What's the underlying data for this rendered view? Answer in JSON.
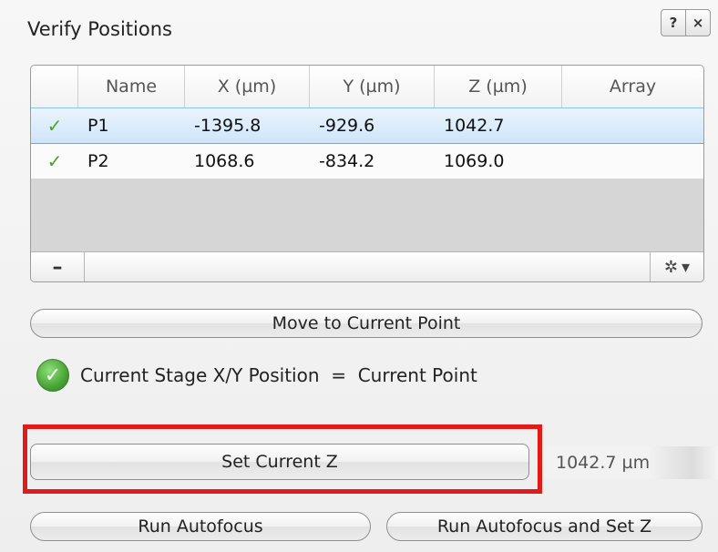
{
  "window": {
    "title": "Verify Positions",
    "help_label": "?",
    "close_label": "×"
  },
  "table": {
    "headers": [
      "",
      "Name",
      "X (µm)",
      "Y (µm)",
      "Z (µm)",
      "Array"
    ],
    "rows": [
      {
        "status": "✓",
        "name": "P1",
        "x": "-1395.8",
        "y": "-929.6",
        "z": "1042.7",
        "array": ""
      },
      {
        "status": "✓",
        "name": "P2",
        "x": "1068.6",
        "y": "-834.2",
        "z": "1069.0",
        "array": ""
      }
    ],
    "remove_label": "–",
    "options_label": "✲",
    "options_arrow": "▾"
  },
  "actions": {
    "move_label": "Move to Current Point",
    "set_z_label": "Set Current Z",
    "run_autofocus_label": "Run Autofocus",
    "run_autofocus_set_z_label": "Run Autofocus and Set Z"
  },
  "status": {
    "icon": "check-circle-icon",
    "text": "Current Stage X/Y Position  =  Current Point",
    "icon_glyph": "✓"
  },
  "current_z": "1042.7 µm",
  "colors": {
    "selection": "#cfe5fb",
    "highlight_border": "#e01b1b",
    "check_green": "#4ea12d"
  }
}
